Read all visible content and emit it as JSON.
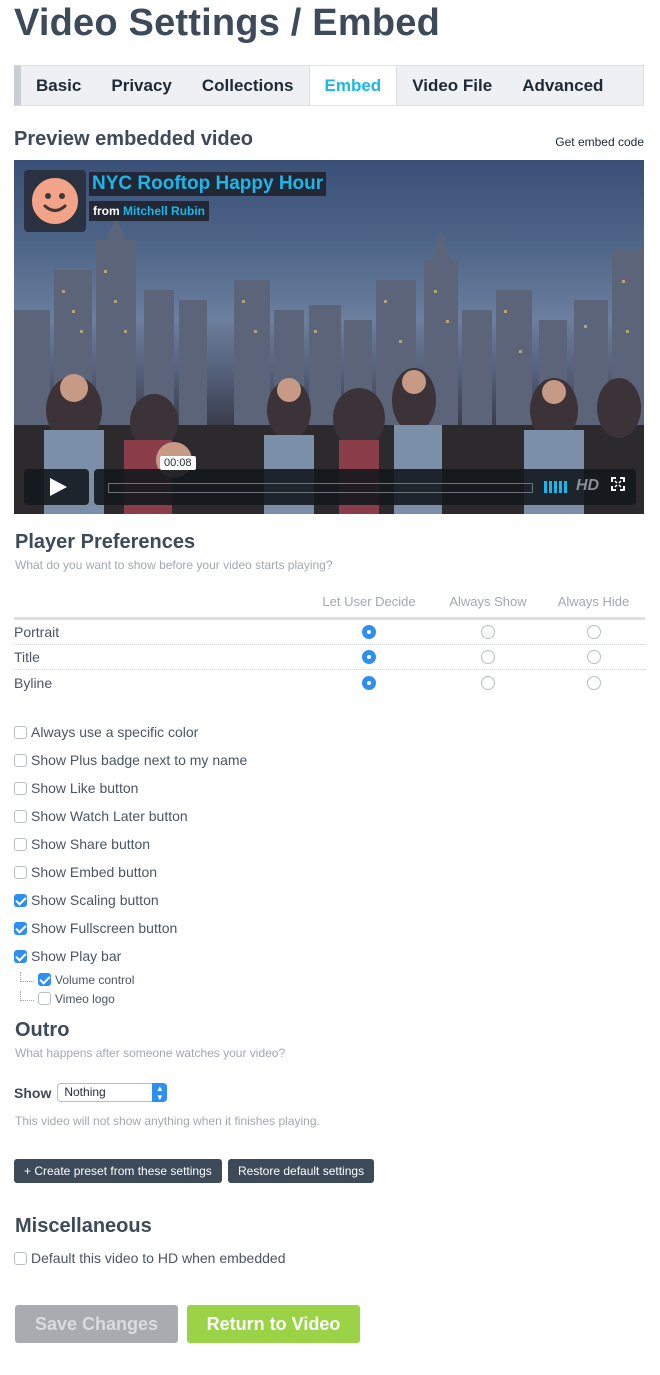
{
  "page": {
    "title": "Video Settings / Embed"
  },
  "tabs": [
    {
      "label": "Basic"
    },
    {
      "label": "Privacy"
    },
    {
      "label": "Collections"
    },
    {
      "label": "Embed"
    },
    {
      "label": "Video File"
    },
    {
      "label": "Advanced"
    }
  ],
  "active_tab": "Embed",
  "preview": {
    "heading": "Preview embedded video",
    "get_code_link": "Get embed code",
    "video_title": "NYC Rooftop Happy Hour",
    "byline_prefix": "from",
    "byline_author": "Mitchell Rubin",
    "timestamp": "00:08",
    "hd_label": "HD"
  },
  "player_prefs": {
    "heading": "Player Preferences",
    "subtitle": "What do you want to show before your video starts playing?",
    "columns": [
      "Let User Decide",
      "Always Show",
      "Always Hide"
    ],
    "rows": [
      {
        "label": "Portrait",
        "selected": "Let User Decide"
      },
      {
        "label": "Title",
        "selected": "Let User Decide"
      },
      {
        "label": "Byline",
        "selected": "Let User Decide"
      }
    ]
  },
  "options": [
    {
      "label": "Always use a specific color",
      "checked": false
    },
    {
      "label": "Show Plus badge next to my name",
      "checked": false
    },
    {
      "label": "Show Like button",
      "checked": false
    },
    {
      "label": "Show Watch Later button",
      "checked": false
    },
    {
      "label": "Show Share button",
      "checked": false
    },
    {
      "label": "Show Embed button",
      "checked": false
    },
    {
      "label": "Show Scaling button",
      "checked": true
    },
    {
      "label": "Show Fullscreen button",
      "checked": true
    },
    {
      "label": "Show Play bar",
      "checked": true
    }
  ],
  "playbar_sub": [
    {
      "label": "Volume control",
      "checked": true
    },
    {
      "label": "Vimeo logo",
      "checked": false
    }
  ],
  "outro": {
    "heading": "Outro",
    "subtitle": "What happens after someone watches your video?",
    "show_label": "Show",
    "selected": "Nothing",
    "note": "This video will not show anything when it finishes playing."
  },
  "buttons": {
    "create_preset": "+ Create preset from these settings",
    "restore_defaults": "Restore default settings",
    "save": "Save Changes",
    "return": "Return to Video"
  },
  "misc": {
    "heading": "Miscellaneous",
    "hd_default_label": "Default this video to HD when embedded",
    "hd_default_checked": false
  },
  "colors": {
    "accent": "#19b7ea",
    "radio_on": "#2f8ff0",
    "dark_button": "#3d4a59",
    "return_button": "#9ad446",
    "save_button_disabled": "#a8abb0"
  }
}
